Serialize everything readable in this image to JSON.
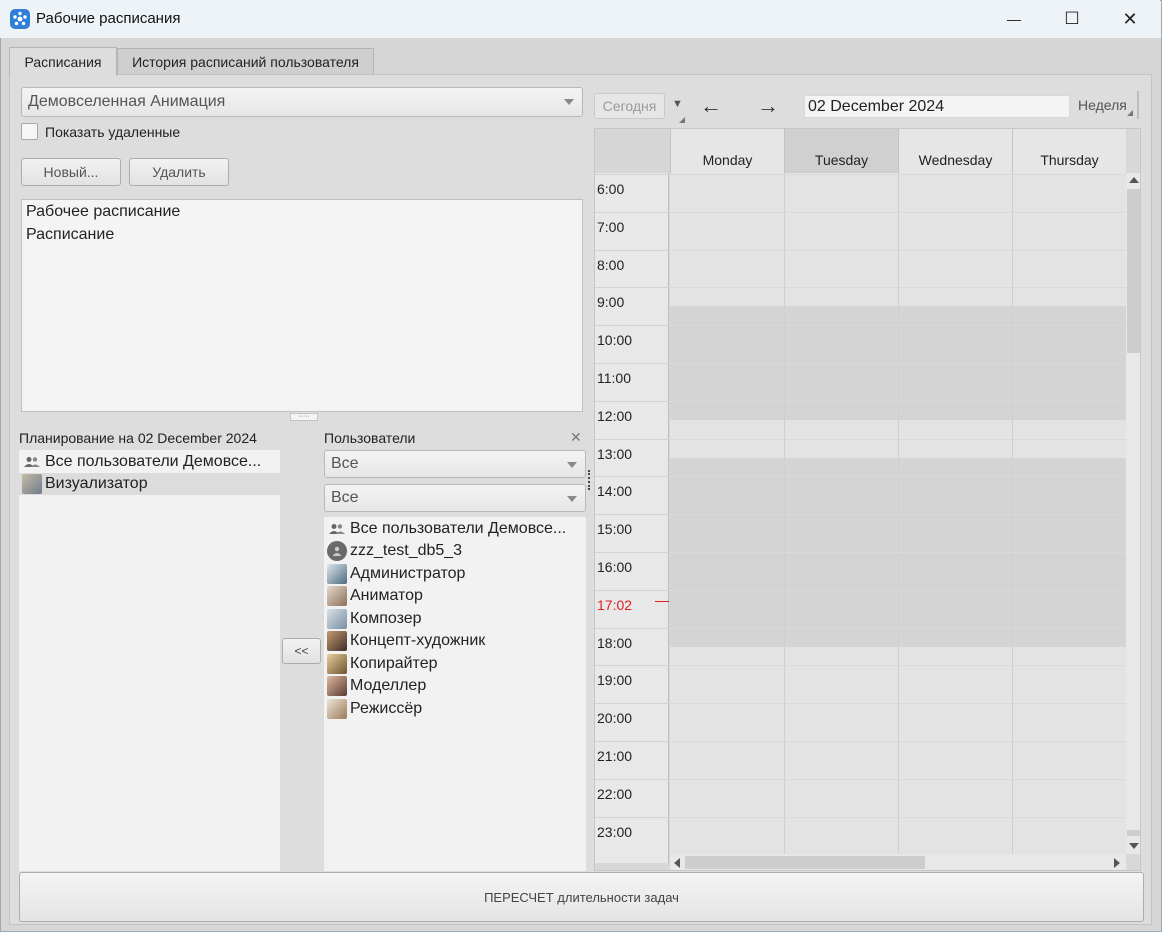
{
  "window": {
    "title": "Рабочие расписания",
    "minimize": "—",
    "maximize": "☐",
    "close": "✕"
  },
  "tabs": [
    {
      "label": "Расписания",
      "active": true
    },
    {
      "label": "История расписаний пользователя",
      "active": false
    }
  ],
  "project_combo": {
    "value": "Демовселенная Анимация"
  },
  "show_deleted": {
    "label": "Показать удаленные",
    "checked": false
  },
  "buttons": {
    "new": "Новый...",
    "delete": "Удалить",
    "move_left": "<<",
    "recalc": "ПЕРЕСЧЕТ длительности задач"
  },
  "schedules": [
    "Рабочее расписание",
    "Расписание"
  ],
  "planning": {
    "label": "Планирование на 02 December 2024",
    "items": [
      {
        "label": "Все пользователи Демовсе...",
        "icon": "group-icon"
      },
      {
        "label": "Визуализатор",
        "icon": "avatar"
      }
    ]
  },
  "users": {
    "label": "Пользователи",
    "filter1": "Все",
    "filter2": "Все",
    "items": [
      {
        "label": "Все пользователи Демовсе...",
        "icon": "group-icon"
      },
      {
        "label": "zzz_test_db5_3",
        "icon": "default-user-icon"
      },
      {
        "label": "Администратор",
        "icon": "avatar"
      },
      {
        "label": "Аниматор",
        "icon": "avatar"
      },
      {
        "label": "Композер",
        "icon": "avatar"
      },
      {
        "label": "Концепт-художник",
        "icon": "avatar"
      },
      {
        "label": "Копирайтер",
        "icon": "avatar"
      },
      {
        "label": "Моделлер",
        "icon": "avatar"
      },
      {
        "label": "Режиссёр",
        "icon": "avatar"
      }
    ]
  },
  "calendar": {
    "today": "Сегодня",
    "prev": "←",
    "next": "→",
    "date": "02 December 2024",
    "view": "Неделя",
    "days": [
      "Monday",
      "Tuesday",
      "Wednesday",
      "Thursday"
    ],
    "hours": [
      "6:00",
      "7:00",
      "8:00",
      "9:00",
      "10:00",
      "11:00",
      "12:00",
      "13:00",
      "14:00",
      "15:00",
      "16:00",
      "17:02",
      "18:00",
      "19:00",
      "20:00",
      "21:00",
      "22:00",
      "23:00"
    ],
    "current_time": "17:02",
    "current_time_color": "#e02020",
    "work_blocks": [
      [
        "9:00",
        "12:00"
      ],
      [
        "13:00",
        "18:00"
      ]
    ]
  }
}
